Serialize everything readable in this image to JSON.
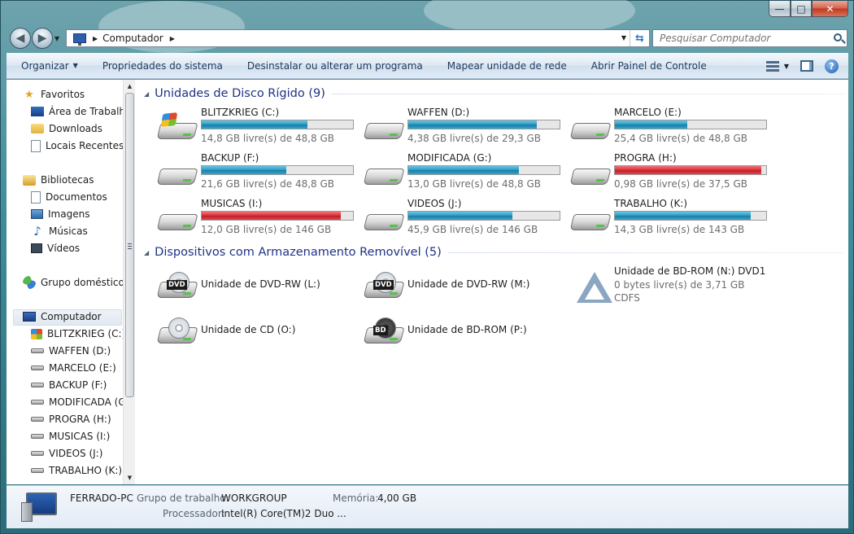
{
  "window": {
    "caption": {
      "min": "—",
      "max": "□",
      "close": "✕"
    }
  },
  "address": {
    "crumb": "Computador",
    "search_placeholder": "Pesquisar Computador"
  },
  "commands": {
    "organize": "Organizar",
    "props": "Propriedades do sistema",
    "uninstall": "Desinstalar ou alterar um programa",
    "map": "Mapear unidade de rede",
    "panel": "Abrir Painel de Controle",
    "help": "?"
  },
  "sidebar": {
    "favorites": "Favoritos",
    "desktop": "Área de Trabalho",
    "downloads": "Downloads",
    "recent": "Locais Recentes",
    "libraries": "Bibliotecas",
    "documents": "Documentos",
    "images": "Imagens",
    "music": "Músicas",
    "videos": "Vídeos",
    "homegroup": "Grupo doméstico",
    "computer": "Computador",
    "drives": [
      "BLITZKRIEG (C:)",
      "WAFFEN (D:)",
      "MARCELO (E:)",
      "BACKUP (F:)",
      "MODIFICADA (G:)",
      "PROGRA (H:)",
      "MUSICAS (I:)",
      "VIDEOS (J:)",
      "TRABALHO (K:)"
    ]
  },
  "hdd_group": {
    "title": "Unidades de Disco Rígido (9)",
    "drives": [
      {
        "name": "BLITZKRIEG (C:)",
        "free": "14,8 GB livre(s) de 48,8 GB",
        "used_fraction": 0.7,
        "critical": false
      },
      {
        "name": "WAFFEN (D:)",
        "free": "4,38 GB livre(s) de 29,3 GB",
        "used_fraction": 0.85,
        "critical": false
      },
      {
        "name": "MARCELO (E:)",
        "free": "25,4 GB livre(s) de 48,8 GB",
        "used_fraction": 0.48,
        "critical": false
      },
      {
        "name": "BACKUP (F:)",
        "free": "21,6 GB livre(s) de 48,8 GB",
        "used_fraction": 0.56,
        "critical": false
      },
      {
        "name": "MODIFICADA (G:)",
        "free": "13,0 GB livre(s) de 48,8 GB",
        "used_fraction": 0.73,
        "critical": false
      },
      {
        "name": "PROGRA (H:)",
        "free": "0,98 GB livre(s) de 37,5 GB",
        "used_fraction": 0.97,
        "critical": true
      },
      {
        "name": "MUSICAS (I:)",
        "free": "12,0 GB livre(s) de 146 GB",
        "used_fraction": 0.92,
        "critical": true
      },
      {
        "name": "VIDEOS (J:)",
        "free": "45,9 GB livre(s) de 146 GB",
        "used_fraction": 0.69,
        "critical": false
      },
      {
        "name": "TRABALHO (K:)",
        "free": "14,3 GB livre(s) de 143 GB",
        "used_fraction": 0.9,
        "critical": false
      }
    ]
  },
  "removable_group": {
    "title": "Dispositivos com Armazenamento Removível (5)",
    "devices": [
      {
        "name": "Unidade de DVD-RW (L:)",
        "badge": "DVD"
      },
      {
        "name": "Unidade de DVD-RW (M:)",
        "badge": "DVD"
      },
      {
        "name": "Unidade de BD-ROM (N:) DVD1",
        "free": "0 bytes livre(s) de 3,71 GB",
        "fs": "CDFS"
      },
      {
        "name": "Unidade de CD (O:)"
      },
      {
        "name": "Unidade de BD-ROM (P:)",
        "badge": "BD"
      }
    ]
  },
  "details": {
    "computer_name": "FERRADO-PC",
    "workgroup_label": "Grupo de trabalho:",
    "workgroup": "WORKGROUP",
    "memory_label": "Memória:",
    "memory": "4,00 GB",
    "processor_label": "Processador:",
    "processor": "Intel(R) Core(TM)2 Duo ..."
  },
  "colors": {
    "bar_normal": "#2b9ac4",
    "bar_critical": "#dc2b36",
    "group_title": "#1e3287"
  },
  "icons": {
    "window_controls": [
      "minimize-icon",
      "maximize-icon",
      "close-icon"
    ],
    "nav": [
      "back-arrow-icon",
      "forward-arrow-icon",
      "refresh-icon",
      "search-icon"
    ],
    "drives": [
      "windows-drive-icon",
      "hard-disk-icon",
      "dvd-drive-icon",
      "bd-rom-icon",
      "cd-drive-icon"
    ]
  }
}
